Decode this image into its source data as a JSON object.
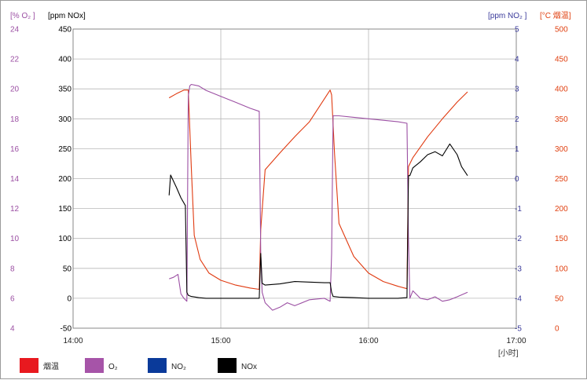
{
  "chart_data": {
    "type": "line",
    "axes_headers": {
      "o2_unit": "[% O₂ ]",
      "nox_unit": "[ppm NOx]",
      "no2_unit": "[ppm NO₂ ]",
      "temp_unit": "[°C 烟温]"
    },
    "x_axis": {
      "label": "[小时]",
      "range_hours": [
        14.0,
        17.0
      ],
      "ticks": [
        {
          "value": 14.0,
          "label": "14:00"
        },
        {
          "value": 15.0,
          "label": "15:00"
        },
        {
          "value": 16.0,
          "label": "16:00"
        },
        {
          "value": 17.0,
          "label": "17:00"
        }
      ]
    },
    "y_axes": {
      "nox": {
        "range": [
          -50,
          450
        ],
        "ticks": [
          "-50",
          "0",
          "50",
          "100",
          "150",
          "200",
          "250",
          "300",
          "350",
          "400",
          "450"
        ],
        "color": "#000000"
      },
      "o2": {
        "range": [
          4,
          24
        ],
        "ticks": [
          "4",
          "6",
          "8",
          "10",
          "12",
          "14",
          "16",
          "18",
          "20",
          "22",
          "24"
        ],
        "color": "#9b4fa3"
      },
      "no2": {
        "range": [
          -5,
          5
        ],
        "ticks": [
          "-5",
          "-4",
          "-3",
          "-2",
          "-1",
          "0",
          "1",
          "2",
          "3",
          "4",
          "5"
        ],
        "color": "#3a3a9a"
      },
      "temp": {
        "range": [
          0,
          500
        ],
        "ticks": [
          "0",
          "50",
          "100",
          "150",
          "200",
          "250",
          "300",
          "350",
          "400",
          "450",
          "500"
        ],
        "color": "#e04010"
      }
    },
    "grid": true,
    "legend_position": "bottom",
    "legend": [
      {
        "name": "烟温",
        "color": "#e8191f"
      },
      {
        "name": "O₂",
        "color": "#a654a8"
      },
      {
        "name": "NO₂",
        "color": "#0a3a9a"
      },
      {
        "name": "NOx",
        "color": "#000000"
      }
    ],
    "series": [
      {
        "name": "烟温",
        "axis": "temp",
        "color": "#e03a10",
        "x": [
          14.65,
          14.7,
          14.75,
          14.78,
          14.8,
          14.82,
          14.86,
          14.92,
          15.0,
          15.1,
          15.2,
          15.26,
          15.27,
          15.3,
          15.4,
          15.5,
          15.6,
          15.74,
          15.75,
          15.77,
          15.8,
          15.9,
          16.0,
          16.1,
          16.2,
          16.26,
          16.27,
          16.3,
          16.4,
          16.5,
          16.6,
          16.67
        ],
        "y": [
          385,
          392,
          398,
          398,
          270,
          155,
          115,
          92,
          80,
          72,
          67,
          65,
          165,
          265,
          293,
          320,
          345,
          398,
          390,
          290,
          175,
          120,
          92,
          78,
          70,
          66,
          270,
          285,
          320,
          350,
          378,
          395
        ]
      },
      {
        "name": "O₂",
        "axis": "o2",
        "color": "#9b4fa3",
        "x": [
          14.65,
          14.68,
          14.71,
          14.73,
          14.75,
          14.77,
          14.78,
          14.79,
          14.8,
          14.85,
          14.9,
          15.0,
          15.1,
          15.2,
          15.26,
          15.27,
          15.28,
          15.3,
          15.35,
          15.4,
          15.45,
          15.5,
          15.6,
          15.7,
          15.74,
          15.75,
          15.76,
          15.8,
          15.9,
          16.0,
          16.1,
          16.2,
          16.26,
          16.27,
          16.28,
          16.3,
          16.35,
          16.4,
          16.45,
          16.5,
          16.55,
          16.6,
          16.67
        ],
        "y": [
          7.3,
          7.4,
          7.6,
          6.3,
          6.0,
          5.8,
          19.5,
          20.2,
          20.3,
          20.2,
          19.9,
          19.5,
          19.1,
          18.7,
          18.5,
          9.0,
          6.4,
          5.7,
          5.2,
          5.4,
          5.7,
          5.5,
          5.9,
          6.0,
          5.8,
          9.0,
          18.2,
          18.2,
          18.1,
          18.0,
          17.9,
          17.8,
          17.7,
          10.0,
          6.0,
          6.5,
          6.0,
          5.9,
          6.1,
          5.8,
          5.9,
          6.1,
          6.4
        ]
      },
      {
        "name": "NOx",
        "axis": "nox",
        "color": "#000000",
        "x": [
          14.65,
          14.66,
          14.7,
          14.73,
          14.76,
          14.77,
          14.78,
          14.8,
          14.85,
          14.9,
          15.0,
          15.1,
          15.2,
          15.26,
          15.27,
          15.28,
          15.3,
          15.4,
          15.5,
          15.6,
          15.7,
          15.74,
          15.75,
          15.76,
          15.8,
          15.9,
          16.0,
          16.1,
          16.2,
          16.26,
          16.27,
          16.28,
          16.3,
          16.35,
          16.4,
          16.45,
          16.5,
          16.55,
          16.6,
          16.63,
          16.67
        ],
        "y": [
          172,
          206,
          185,
          168,
          155,
          10,
          5,
          3,
          1,
          0,
          0,
          0,
          0,
          0,
          75,
          25,
          22,
          24,
          28,
          27,
          26,
          26,
          10,
          3,
          2,
          1,
          0,
          0,
          0,
          1,
          205,
          205,
          218,
          228,
          240,
          245,
          238,
          258,
          240,
          220,
          205
        ]
      }
    ]
  }
}
